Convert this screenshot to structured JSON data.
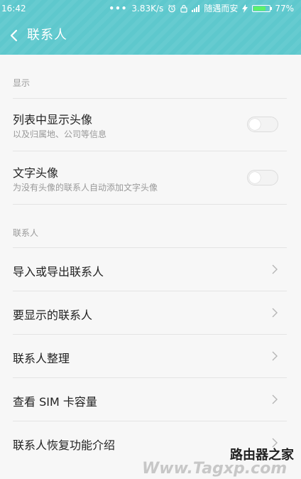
{
  "status_bar": {
    "time": "16:42",
    "network_speed": "3.83K/s",
    "carrier": "随遇而安",
    "battery": "77%",
    "battery_level": 0.77
  },
  "header": {
    "title": "联系人"
  },
  "sections": {
    "display": {
      "label": "显示",
      "items": [
        {
          "title": "列表中显示头像",
          "subtitle": "以及归属地、公司等信息"
        },
        {
          "title": "文字头像",
          "subtitle": "为没有头像的联系人自动添加文字头像"
        }
      ]
    },
    "contacts": {
      "label": "联系人",
      "items": [
        {
          "title": "导入或导出联系人"
        },
        {
          "title": "要显示的联系人"
        },
        {
          "title": "联系人整理"
        },
        {
          "title": "查看 SIM 卡容量"
        },
        {
          "title": "联系人恢复功能介绍"
        }
      ]
    }
  },
  "watermark": {
    "logo": "路由器之家",
    "url": "Www.Tagxp.com"
  },
  "colors": {
    "accent": "#5ec8cd",
    "battery_fill": "#5ef06a"
  }
}
